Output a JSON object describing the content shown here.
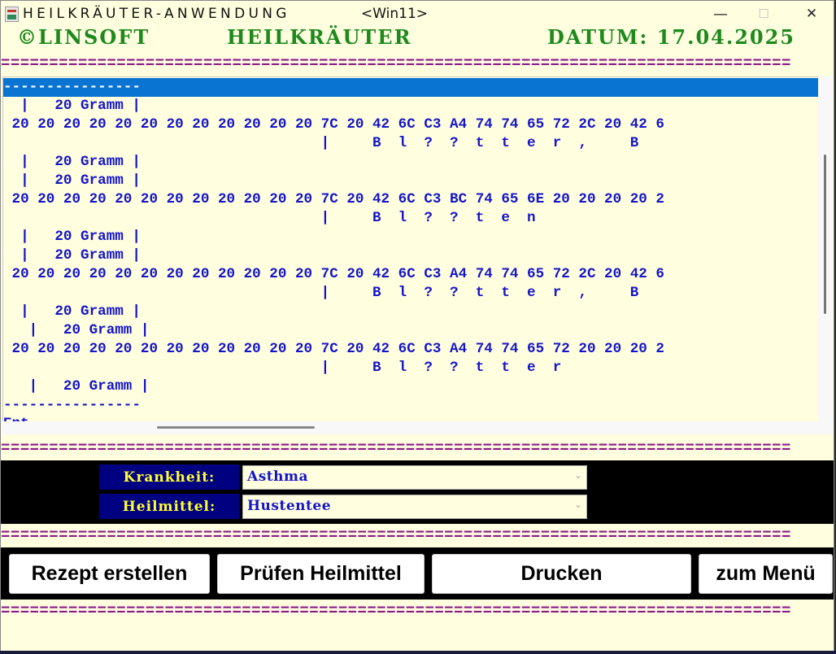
{
  "window": {
    "title": "HEILKRÄUTER-ANWENDUNG",
    "subtitle": "<Win11>",
    "controls": {
      "minimize": "—",
      "maximize": "☐",
      "close": "✕"
    }
  },
  "header": {
    "company": "©LINSOFT",
    "app": "HEILKRÄUTER",
    "date": "DATUM: 17.04.2025"
  },
  "separator": "==================================================================================",
  "output_lines": [
    "----------------",
    "  |   20 Gramm |",
    " 20 20 20 20 20 20 20 20 20 20 20 20 7C 20 42 6C C3 A4 74 74 65 72 2C 20 42 6",
    "                                     |     B  l  ?  ?  t  t  e  r  ,     B",
    "  |   20 Gramm |",
    "  |   20 Gramm |",
    " 20 20 20 20 20 20 20 20 20 20 20 20 7C 20 42 6C C3 BC 74 65 6E 20 20 20 20 2",
    "                                     |     B  l  ?  ?  t  e  n",
    "  |   20 Gramm |",
    "  |   20 Gramm |",
    " 20 20 20 20 20 20 20 20 20 20 20 20 7C 20 42 6C C3 A4 74 74 65 72 2C 20 42 6",
    "                                     |     B  l  ?  ?  t  t  e  r  ,     B",
    "  |   20 Gramm |",
    "   |   20 Gramm |",
    " 20 20 20 20 20 20 20 20 20 20 20 20 7C 20 42 6C C3 A4 74 74 65 72 20 20 20 2",
    "                                     |     B  l  ?  ?  t  t  e  r",
    "   |   20 Gramm |",
    "----------------",
    "Ent..."
  ],
  "form": {
    "krankheit_label": "Krankheit:",
    "krankheit_value": "Asthma",
    "heilmittel_label": "Heilmittel:",
    "heilmittel_value": "Hustentee"
  },
  "buttons": {
    "rezept": "Rezept erstellen",
    "pruefen": "Prüfen Heilmittel",
    "drucken": "Drucken",
    "menu": "zum Menü"
  },
  "colors": {
    "background": "#ffffe0",
    "header_green": "#1e8a1e",
    "separator_purple": "#8b1a8b",
    "text_blue": "#1515c8",
    "label_bg": "#000080",
    "label_fg": "#ffff33",
    "selection": "#0a74d2"
  }
}
